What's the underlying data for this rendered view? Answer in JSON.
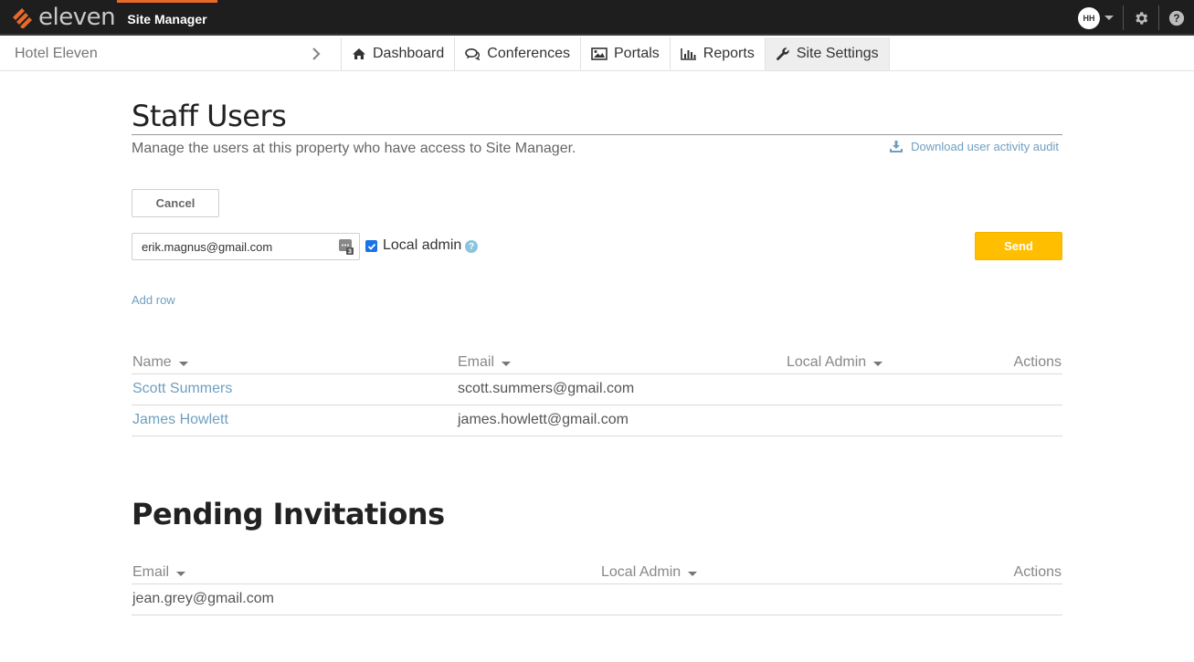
{
  "topbar": {
    "brand": "eleven",
    "app_name": "Site Manager",
    "avatar_initials": "HH",
    "accent_color": "#e8692a"
  },
  "nav": {
    "breadcrumb": "Hotel Eleven",
    "tabs": [
      {
        "label": "Dashboard",
        "icon": "home-icon",
        "active": false
      },
      {
        "label": "Conferences",
        "icon": "chat-icon",
        "active": false
      },
      {
        "label": "Portals",
        "icon": "image-icon",
        "active": false
      },
      {
        "label": "Reports",
        "icon": "bar-chart-icon",
        "active": false
      },
      {
        "label": "Site Settings",
        "icon": "wrench-icon",
        "active": true
      }
    ]
  },
  "staff": {
    "title": "Staff Users",
    "subtitle": "Manage the users at this property who have access to Site Manager.",
    "download_label": "Download user activity audit",
    "cancel_label": "Cancel",
    "email_value": "erik.magnus@gmail.com",
    "local_admin_label": "Local admin",
    "local_admin_checked": true,
    "send_label": "Send",
    "send_color": "#ffbf00",
    "add_row_label": "Add row",
    "columns": {
      "name": "Name",
      "email": "Email",
      "local_admin": "Local Admin",
      "actions": "Actions"
    },
    "rows": [
      {
        "name": "Scott Summers",
        "email": "scott.summers@gmail.com"
      },
      {
        "name": "James Howlett",
        "email": "james.howlett@gmail.com"
      }
    ]
  },
  "pending": {
    "title": "Pending Invitations",
    "columns": {
      "email": "Email",
      "local_admin": "Local Admin",
      "actions": "Actions"
    },
    "rows": [
      {
        "email": "jean.grey@gmail.com"
      }
    ]
  }
}
